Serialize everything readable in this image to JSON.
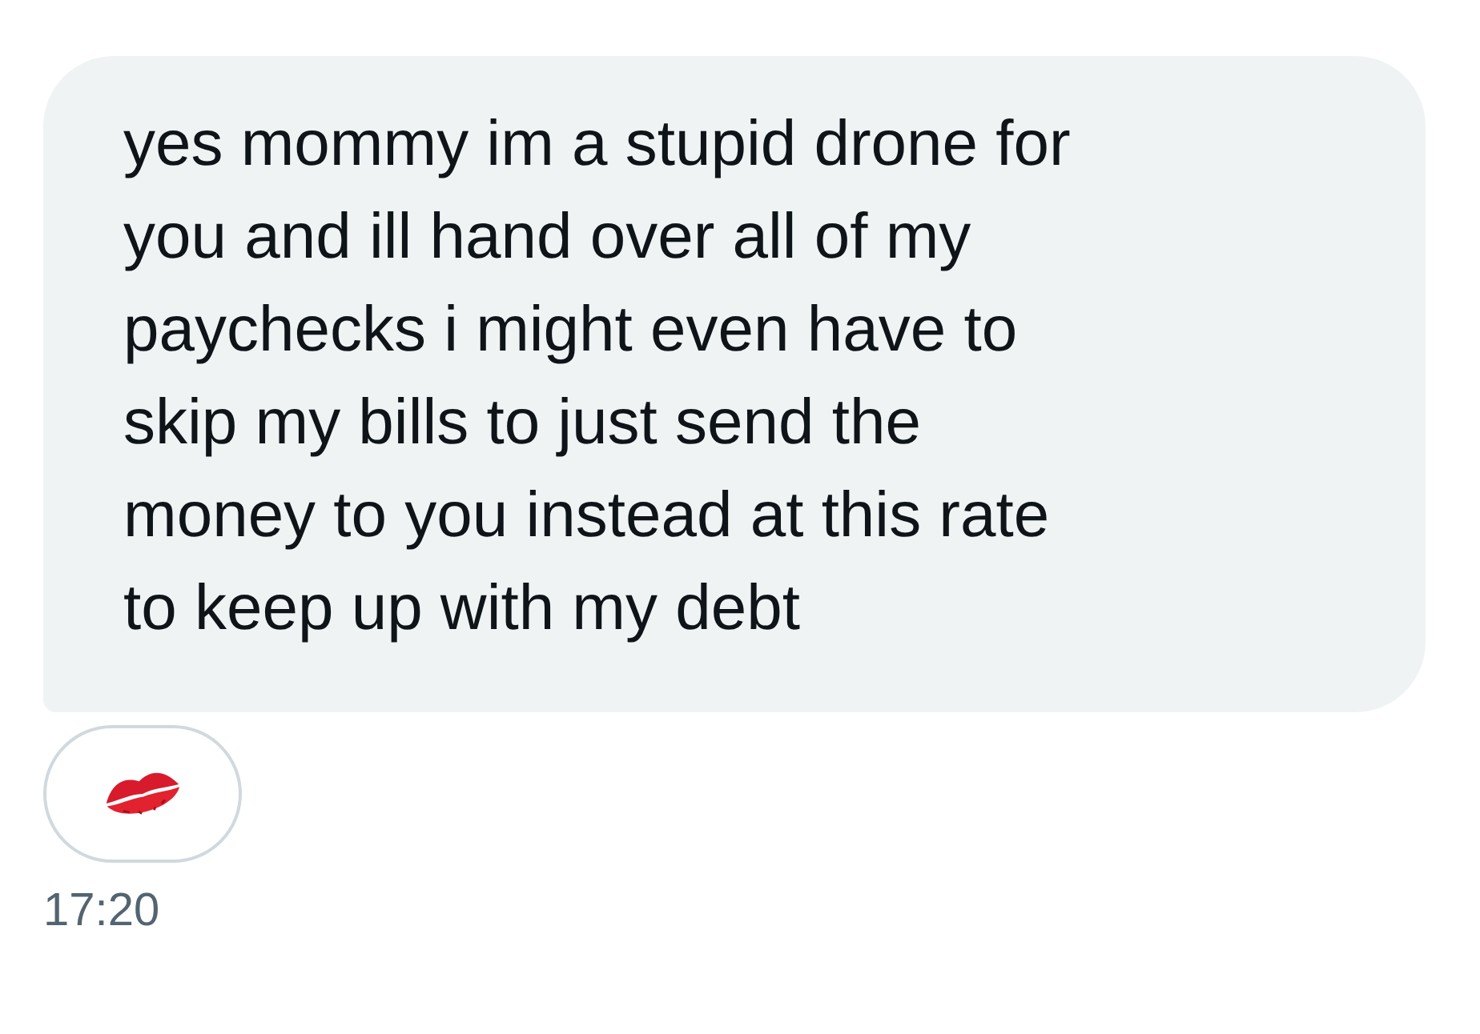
{
  "message": {
    "lines": [
      "yes mommy im a stupid drone for",
      "you and ill hand over all of my",
      "paychecks i might even have to",
      "skip my bills to just send the",
      "money to you instead at this rate",
      "to keep up with my debt"
    ]
  },
  "reaction": {
    "kind": "kiss"
  },
  "time": "17:20"
}
